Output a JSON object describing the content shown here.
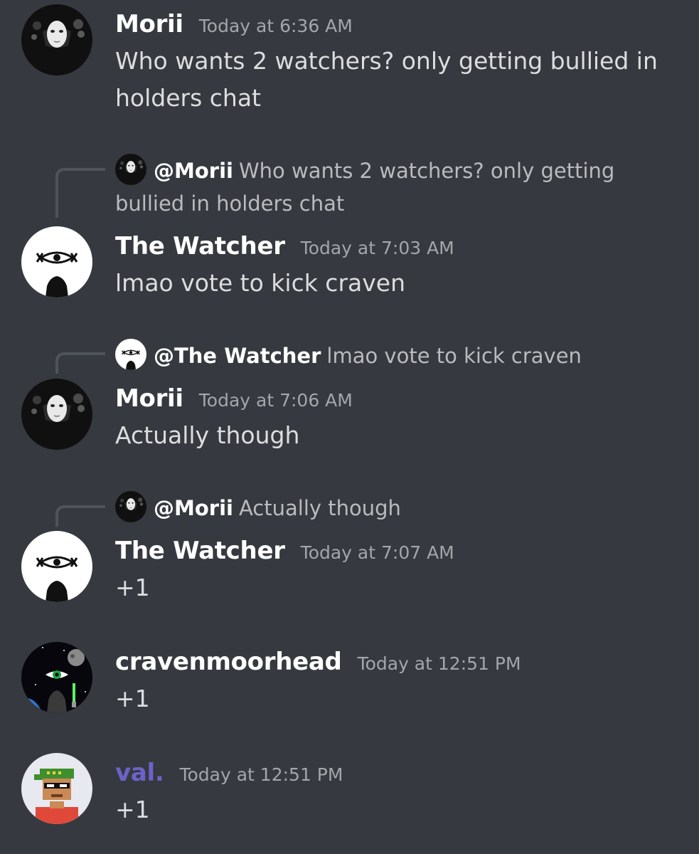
{
  "messages": [
    {
      "author": "Morii",
      "timestamp": "Today at 6:36 AM",
      "content": "Who wants 2 watchers? only getting bullied in holders chat"
    },
    {
      "reply": {
        "mention": "@Morii",
        "text": "Who wants 2 watchers? only getting bullied in holders chat"
      },
      "author": "The Watcher",
      "timestamp": "Today at 7:03 AM",
      "content": "lmao vote to kick craven"
    },
    {
      "reply": {
        "mention": "@The Watcher",
        "text": "lmao vote to kick craven"
      },
      "author": "Morii",
      "timestamp": "Today at 7:06 AM",
      "content": "Actually though"
    },
    {
      "reply": {
        "mention": "@Morii",
        "text": "Actually though"
      },
      "author": "The Watcher",
      "timestamp": "Today at 7:07 AM",
      "content": "+1"
    },
    {
      "author": "cravenmoorhead",
      "timestamp": "Today at 12:51 PM",
      "content": "+1"
    },
    {
      "author": "val.",
      "author_color": "#6b63c9",
      "timestamp": "Today at 12:51 PM",
      "content": "+1"
    }
  ],
  "colors": {
    "background": "#36393f",
    "text": "#dcddde",
    "muted": "#a3a6aa",
    "reply_spine": "#4f545c"
  },
  "icons": {
    "morii_avatar": "white-mask-icon",
    "watcher_avatar": "eye-and-hood-icon",
    "craven_avatar": "green-eye-space-icon",
    "val_avatar": "pixel-character-icon"
  }
}
